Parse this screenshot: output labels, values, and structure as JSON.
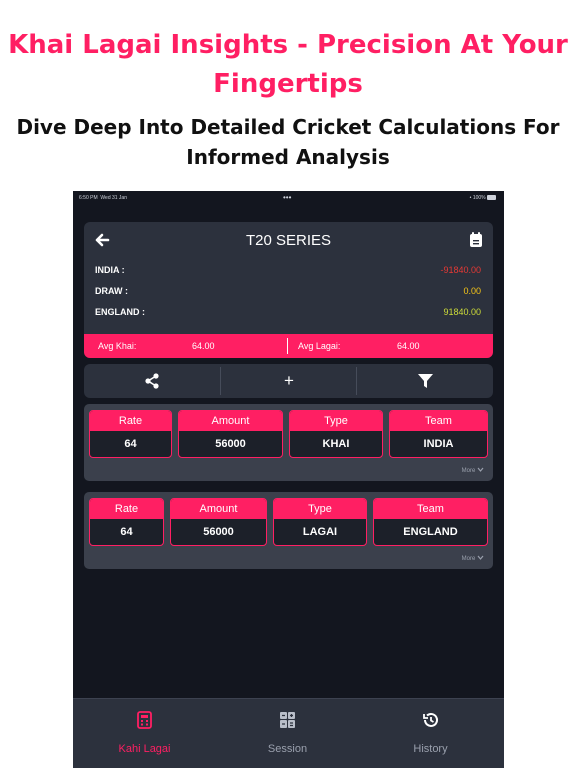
{
  "promo": {
    "headline_line1": "Khai Lagai Insights - Precision At Your",
    "headline_line2": "Fingertips",
    "subline_line1": "Dive Deep Into Detailed Cricket Calculations For",
    "subline_line2": "Informed Analysis"
  },
  "status_bar": {
    "time": "6:50 PM",
    "date": "Wed 31 Jan",
    "dots": "•••",
    "battery": "100%"
  },
  "summary": {
    "title": "T20 SERIES",
    "rows": [
      {
        "name": "INDIA :",
        "value": "-91840.00",
        "color": "#e53935"
      },
      {
        "name": "DRAW :",
        "value": "0.00",
        "color": "#f5c518"
      },
      {
        "name": "ENGLAND :",
        "value": "91840.00",
        "color": "#cddc39"
      }
    ],
    "avg_khai_label": "Avg Khai:",
    "avg_khai_value": "64.00",
    "avg_lagai_label": "Avg Lagai:",
    "avg_lagai_value": "64.00"
  },
  "toolbar": {
    "plus_label": "+",
    "icons": [
      "share-icon",
      "plus-icon",
      "filter-icon"
    ]
  },
  "bets": [
    {
      "rate_label": "Rate",
      "rate": "64",
      "amount_label": "Amount",
      "amount": "56000",
      "type_label": "Type",
      "type": "KHAI",
      "team_label": "Team",
      "team": "INDIA",
      "more_label": "More"
    },
    {
      "rate_label": "Rate",
      "rate": "64",
      "amount_label": "Amount",
      "amount": "56000",
      "type_label": "Type",
      "type": "LAGAI",
      "team_label": "Team",
      "team": "ENGLAND",
      "more_label": "More"
    }
  ],
  "tabs": [
    {
      "label": "Kahi Lagai",
      "icon": "calculator-icon",
      "active": true
    },
    {
      "label": "Session",
      "icon": "session-calculator-icon",
      "active": false
    },
    {
      "label": "History",
      "icon": "history-icon",
      "active": false
    }
  ],
  "colors": {
    "accent": "#ff1f63",
    "background": "#13161f",
    "card": "#2c313d",
    "tab_inactive": "#9aa0ad"
  }
}
